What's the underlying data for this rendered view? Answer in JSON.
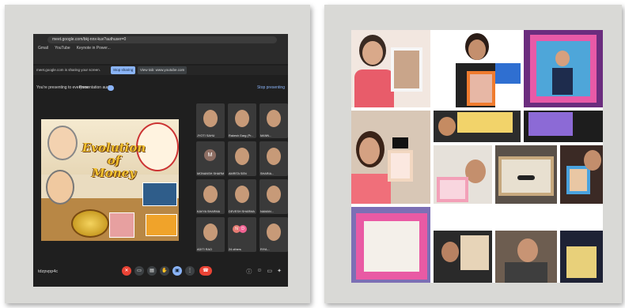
{
  "meet": {
    "url": "meet.google.com/bkj-nnx-kuv?authuser=0",
    "bookmarks": [
      "Gmail",
      "YouTube",
      "Keynote in Power..."
    ],
    "share_message": "meet.google.com is sharing your screen.",
    "stop_sharing_label": "Stop sharing",
    "share_tab_label": "View tab: www.youtube.com",
    "presenting_label": "You're presenting to everyone",
    "presentation_audio_label": "Presentation audio",
    "stop_presenting_label": "Stop presenting",
    "meeting_code": "tdzpvpp4c",
    "participant_tiles": [
      {
        "label": "JYOTI SAHU"
      },
      {
        "label": "Rakesh Garg (Pr..."
      },
      {
        "label": "MANN..."
      },
      {
        "label": "PRIYA SHAH"
      },
      {
        "label": "NAINA SHARMA"
      },
      {
        "label": "SHARIKA..."
      },
      {
        "label": "MONANSH SHARM..."
      },
      {
        "label": "AMRITA SEN"
      },
      {
        "label": "SHARIA..."
      },
      {
        "label": "KAVYA SHARMA"
      },
      {
        "label": "DEVESH SHARMA"
      },
      {
        "label": "NAMAN..."
      },
      {
        "label": "ADITI RAO"
      },
      {
        "label": "24 others"
      },
      {
        "label": "RIYA..."
      }
    ],
    "avatar_letter": "M",
    "others_initials": [
      "N",
      "D"
    ]
  },
  "slide": {
    "title_line1": "Evolution",
    "title_line2": "of",
    "title_line3": "Money"
  }
}
